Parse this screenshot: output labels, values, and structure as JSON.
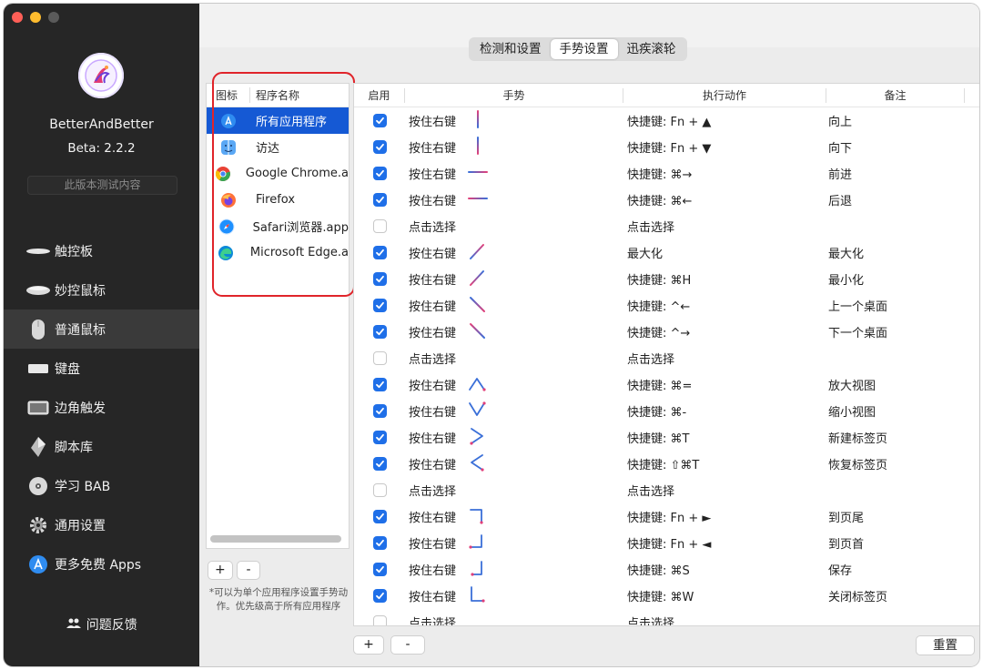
{
  "sidebar": {
    "app_name": "BetterAndBetter",
    "version": "Beta: 2.2.2",
    "beta_button": "此版本测试内容",
    "items": [
      {
        "label": "触控板",
        "icon": "trackpad-icon"
      },
      {
        "label": "妙控鼠标",
        "icon": "magic-mouse-icon"
      },
      {
        "label": "普通鼠标",
        "icon": "mouse-icon",
        "active": true
      },
      {
        "label": "键盘",
        "icon": "keyboard-icon"
      },
      {
        "label": "边角触发",
        "icon": "corner-trigger-icon"
      },
      {
        "label": "脚本库",
        "icon": "script-library-icon"
      },
      {
        "label": "学习 BAB",
        "icon": "learn-disc-icon"
      },
      {
        "label": "通用设置",
        "icon": "gear-icon"
      },
      {
        "label": "更多免费 Apps",
        "icon": "app-store-icon"
      }
    ],
    "feedback": "问题反馈"
  },
  "tabs": [
    "检测和设置",
    "手势设置",
    "迅疾滚轮"
  ],
  "active_tab": 1,
  "apps_panel": {
    "col_icon": "图标",
    "col_name": "程序名称",
    "apps": [
      {
        "name": "所有应用程序",
        "icon": "app-store-icon",
        "selected": true
      },
      {
        "name": "访达",
        "icon": "finder-icon"
      },
      {
        "name": "Google Chrome.a",
        "icon": "chrome-icon"
      },
      {
        "name": "Firefox",
        "icon": "firefox-icon"
      },
      {
        "name": "Safari浏览器.app",
        "icon": "safari-icon"
      },
      {
        "name": "Microsoft Edge.a",
        "icon": "edge-icon"
      }
    ],
    "add": "+",
    "remove": "-",
    "note": "*可以为单个应用程序设置手势动作。优先级高于所有应用程序"
  },
  "gesture_table": {
    "headers": [
      "启用",
      "手势",
      "执行动作",
      "备注"
    ],
    "rows": [
      {
        "on": true,
        "gesture": "按住右键",
        "shape": "up",
        "action": "快捷键: Fn + ▲",
        "remark": "向上"
      },
      {
        "on": true,
        "gesture": "按住右键",
        "shape": "down",
        "action": "快捷键: Fn + ▼",
        "remark": "向下"
      },
      {
        "on": true,
        "gesture": "按住右键",
        "shape": "left",
        "action": "快捷键: ⌘→",
        "remark": "前进"
      },
      {
        "on": true,
        "gesture": "按住右键",
        "shape": "right",
        "action": "快捷键: ⌘←",
        "remark": "后退"
      },
      {
        "on": false,
        "gesture": "点击选择",
        "shape": "",
        "action": "点击选择",
        "remark": ""
      },
      {
        "on": true,
        "gesture": "按住右键",
        "shape": "diag-up-right",
        "action": "最大化",
        "remark": "最大化"
      },
      {
        "on": true,
        "gesture": "按住右键",
        "shape": "diag-down-left",
        "action": "快捷键: ⌘H",
        "remark": "最小化"
      },
      {
        "on": true,
        "gesture": "按住右键",
        "shape": "diag-down-right",
        "action": "快捷键: ^←",
        "remark": "上一个桌面"
      },
      {
        "on": true,
        "gesture": "按住右键",
        "shape": "diag-up-left",
        "action": "快捷键: ^→",
        "remark": "下一个桌面"
      },
      {
        "on": false,
        "gesture": "点击选择",
        "shape": "",
        "action": "点击选择",
        "remark": ""
      },
      {
        "on": true,
        "gesture": "按住右键",
        "shape": "caret-up",
        "action": "快捷键: ⌘=",
        "remark": "放大视图"
      },
      {
        "on": true,
        "gesture": "按住右键",
        "shape": "caret-down",
        "action": "快捷键: ⌘-",
        "remark": "缩小视图"
      },
      {
        "on": true,
        "gesture": "按住右键",
        "shape": "caret-right",
        "action": "快捷键: ⌘T",
        "remark": "新建标签页"
      },
      {
        "on": true,
        "gesture": "按住右键",
        "shape": "caret-left",
        "action": "快捷键: ⇧⌘T",
        "remark": "恢复标签页"
      },
      {
        "on": false,
        "gesture": "点击选择",
        "shape": "",
        "action": "点击选择",
        "remark": ""
      },
      {
        "on": true,
        "gesture": "按住右键",
        "shape": "corner-right-down",
        "action": "快捷键: Fn + ►",
        "remark": "到页尾"
      },
      {
        "on": true,
        "gesture": "按住右键",
        "shape": "corner-down-left",
        "action": "快捷键: Fn + ◄",
        "remark": "到页首"
      },
      {
        "on": true,
        "gesture": "按住右键",
        "shape": "corner-down-left-2",
        "action": "快捷键: ⌘S",
        "remark": "保存"
      },
      {
        "on": true,
        "gesture": "按住右键",
        "shape": "corner-down-right",
        "action": "快捷键: ⌘W",
        "remark": "关闭标签页"
      },
      {
        "on": false,
        "gesture": "点击选择",
        "shape": "",
        "action": "点击选择",
        "remark": ""
      }
    ],
    "add": "+",
    "remove": "-",
    "reset": "重置"
  },
  "colors": {
    "accent": "#1f6fe8",
    "selection": "#1559d4",
    "highlight_box": "#e0242a",
    "gesture_pink": "#e0407a",
    "gesture_blue": "#3a6fd8"
  }
}
